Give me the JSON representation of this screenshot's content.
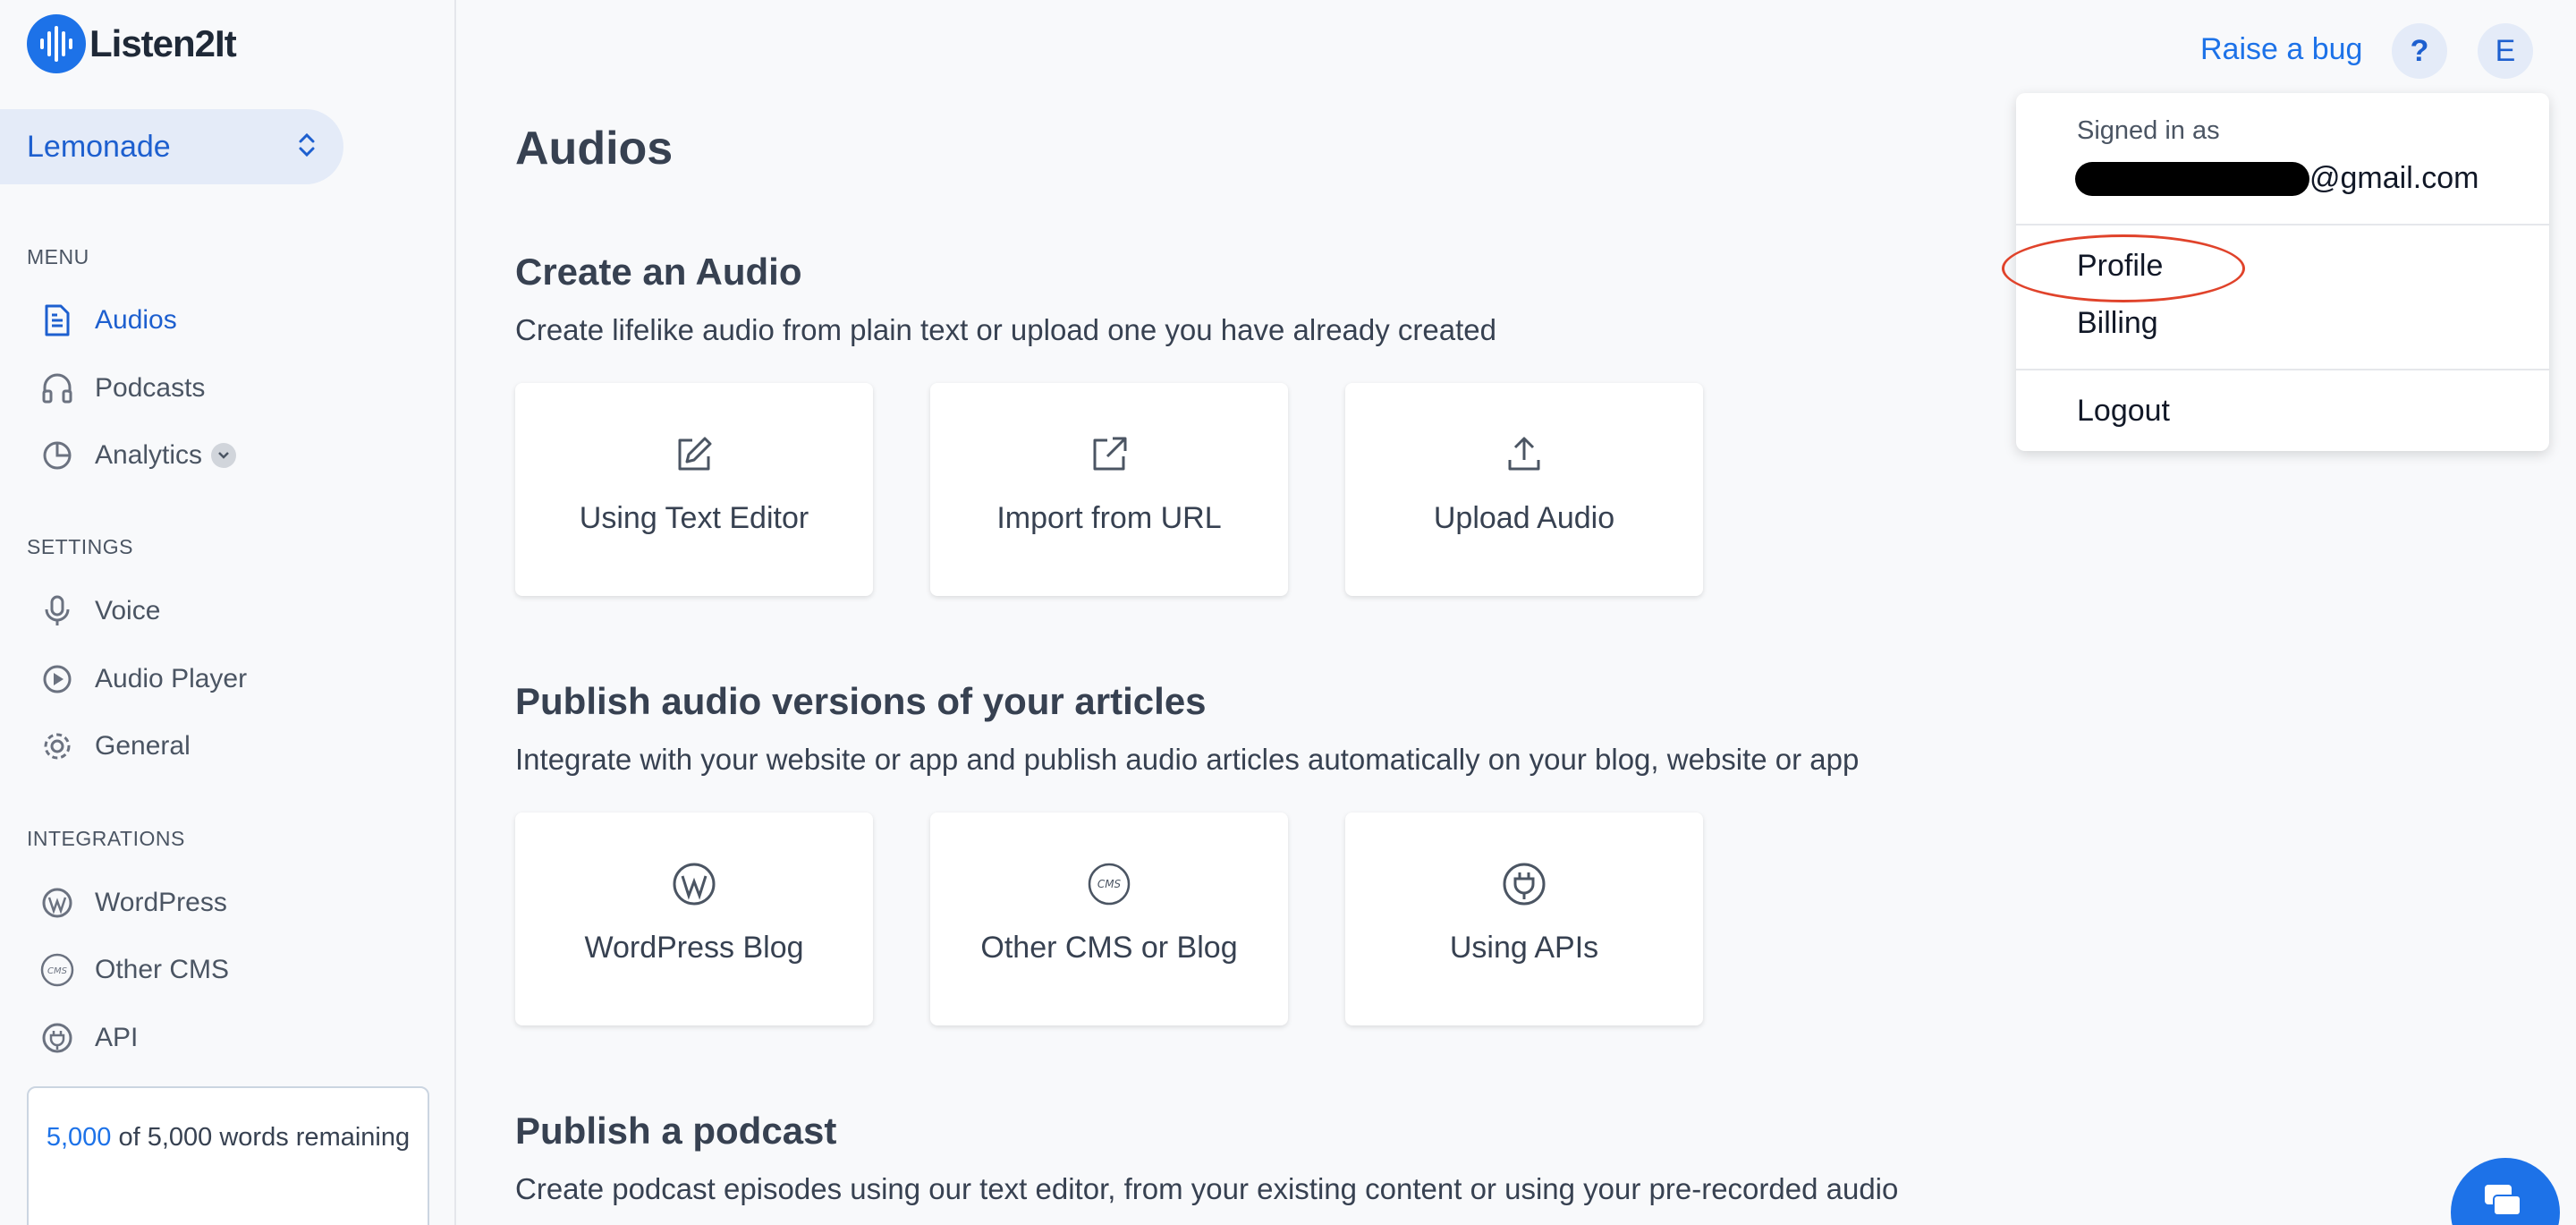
{
  "app": {
    "logo_text": "Listen2It"
  },
  "workspace": {
    "name": "Lemonade"
  },
  "sidebar": {
    "menu_label": "MENU",
    "menu_items": [
      {
        "label": "Audios",
        "icon": "document-icon",
        "active": true
      },
      {
        "label": "Podcasts",
        "icon": "headphones-icon"
      },
      {
        "label": "Analytics",
        "icon": "pie-chart-icon"
      }
    ],
    "settings_label": "SETTINGS",
    "settings_items": [
      {
        "label": "Voice",
        "icon": "microphone-icon"
      },
      {
        "label": "Audio Player",
        "icon": "play-circle-icon"
      },
      {
        "label": "General",
        "icon": "gear-icon"
      }
    ],
    "integrations_label": "INTEGRATIONS",
    "integration_items": [
      {
        "label": "WordPress",
        "icon": "wordpress-icon"
      },
      {
        "label": "Other CMS",
        "icon": "cms-icon"
      },
      {
        "label": "API",
        "icon": "plug-icon"
      }
    ],
    "words": {
      "used": "5,000",
      "rest": " of 5,000 words remaining"
    }
  },
  "topbar": {
    "raise_bug": "Raise a bug",
    "help": "?",
    "avatar": "E"
  },
  "main": {
    "title": "Audios",
    "sections": [
      {
        "title": "Create an Audio",
        "desc": "Create lifelike audio from plain text or upload one you have already created",
        "cards": [
          "Using Text Editor",
          "Import from URL",
          "Upload Audio"
        ]
      },
      {
        "title": "Publish audio versions of your articles",
        "desc": "Integrate with your website or app and publish audio articles automatically on your blog, website or app",
        "cards": [
          "WordPress Blog",
          "Other CMS or Blog",
          "Using APIs"
        ]
      },
      {
        "title": "Publish a podcast",
        "desc": "Create podcast episodes using our text editor, from your existing content or using your pre-recorded audio"
      }
    ]
  },
  "dropdown": {
    "signed_in_as": "Signed in as",
    "email_suffix": "@gmail.com",
    "profile": "Profile",
    "billing": "Billing",
    "logout": "Logout"
  },
  "colors": {
    "accent": "#1d72e8",
    "highlight": "#e0432b"
  }
}
